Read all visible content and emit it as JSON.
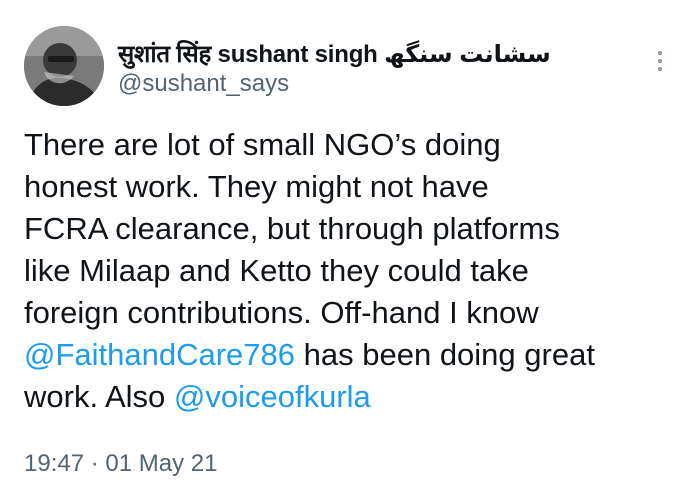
{
  "tweet": {
    "author": {
      "display_name": "सुशांत सिंह sushant singh سشانت سنگھ",
      "handle": "@sushant_says",
      "avatar_icon": "profile-photo"
    },
    "more_icon": "more-vertical-icon",
    "text_segments": [
      {
        "type": "text",
        "value": "There are lot of small NGO’s doing\nhonest work. They might not have\nFCRA clearance, but through platforms\nlike Milaap and Ketto they could take\nforeign contributions. Off-hand I know\n"
      },
      {
        "type": "mention",
        "value": "@FaithandCare786"
      },
      {
        "type": "text",
        "value": " has been doing great\nwork. Also "
      },
      {
        "type": "mention",
        "value": "@voiceofkurla"
      }
    ],
    "timestamp": "19:47 · 01 May 21"
  },
  "colors": {
    "text": "#0f1419",
    "secondary": "#536471",
    "link": "#1d9bf0",
    "background": "#ffffff"
  }
}
